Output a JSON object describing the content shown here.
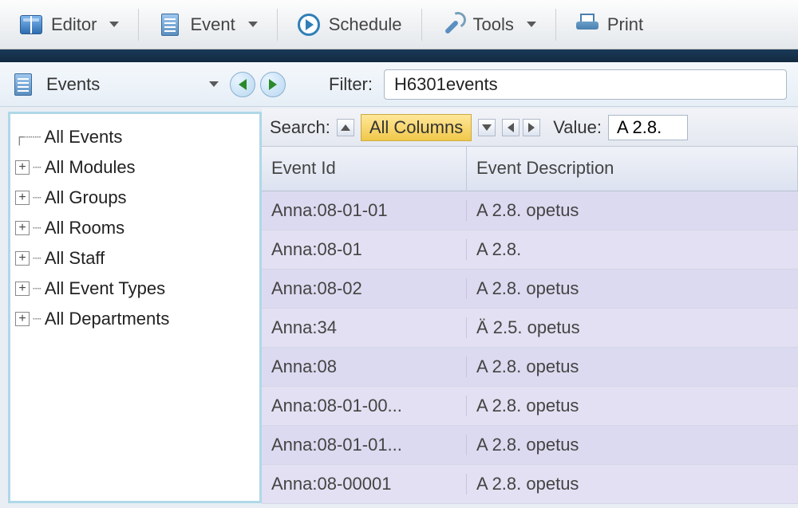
{
  "toolbar": {
    "editor_label": "Editor",
    "event_label": "Event",
    "schedule_label": "Schedule",
    "tools_label": "Tools",
    "print_label": "Print"
  },
  "secondbar": {
    "panel_label": "Events",
    "filter_label": "Filter:",
    "filter_value": "H6301events"
  },
  "sidebar": {
    "items": [
      {
        "label": "All Events",
        "expandable": false
      },
      {
        "label": "All Modules",
        "expandable": true
      },
      {
        "label": "All Groups",
        "expandable": true
      },
      {
        "label": "All Rooms",
        "expandable": true
      },
      {
        "label": "All Staff",
        "expandable": true
      },
      {
        "label": "All Event Types",
        "expandable": true
      },
      {
        "label": "All Departments",
        "expandable": true
      }
    ]
  },
  "search": {
    "label": "Search:",
    "column_chip": "All Columns",
    "value_label": "Value:",
    "value_text": "A 2.8."
  },
  "table": {
    "headers": {
      "id": "Event Id",
      "desc": "Event Description"
    },
    "rows": [
      {
        "id": "Anna:08-01-01",
        "desc": "A 2.8. opetus"
      },
      {
        "id": "Anna:08-01",
        "desc": "A 2.8."
      },
      {
        "id": "Anna:08-02",
        "desc": "A 2.8. opetus"
      },
      {
        "id": "Anna:34",
        "desc": "Ä 2.5. opetus"
      },
      {
        "id": "Anna:08",
        "desc": "A 2.8. opetus"
      },
      {
        "id": "Anna:08-01-00...",
        "desc": "A 2.8. opetus"
      },
      {
        "id": "Anna:08-01-01...",
        "desc": "A 2.8. opetus"
      },
      {
        "id": "Anna:08-00001",
        "desc": "A 2.8. opetus"
      }
    ]
  }
}
